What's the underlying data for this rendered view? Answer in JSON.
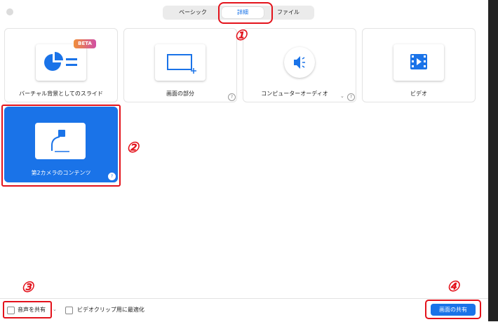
{
  "tabs": {
    "basic": "ベーシック",
    "advanced": "詳細",
    "files": "ファイル"
  },
  "options": [
    {
      "label": "バーチャル背景としてのスライド",
      "badge": "BETA",
      "icon": "slides-icon"
    },
    {
      "label": "画面の部分",
      "icon": "screen-portion-icon"
    },
    {
      "label": "コンピューターオーディオ",
      "icon": "audio-icon"
    },
    {
      "label": "ビデオ",
      "icon": "video-icon"
    }
  ],
  "selected_option": {
    "label": "第2カメラのコンテンツ",
    "icon": "second-camera-icon"
  },
  "footer": {
    "share_sound": "音声を共有",
    "optimize_video": "ビデオクリップ用に最適化",
    "share_button": "画面の共有"
  },
  "annotations": [
    "①",
    "②",
    "③",
    "④"
  ],
  "colors": {
    "accent": "#1a73e8",
    "annotation": "#e3121b"
  }
}
